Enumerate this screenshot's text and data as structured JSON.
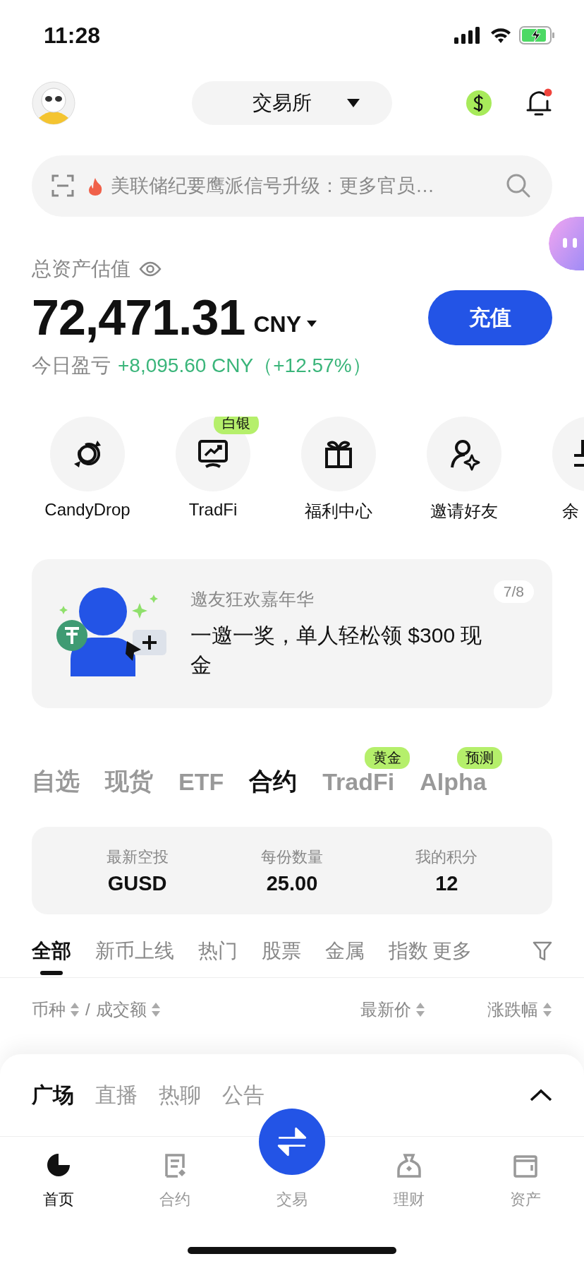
{
  "status_bar": {
    "time": "11:28"
  },
  "header": {
    "exchange_selector": {
      "label": "交易所"
    },
    "notifications": {
      "unread": true
    }
  },
  "search": {
    "placeholder": "美联储纪要鹰派信号升级：更多官员…"
  },
  "assets": {
    "label": "总资产估值",
    "value": "72,471.31",
    "currency": "CNY",
    "pnl_label": "今日盈亏",
    "pnl_value": "+8,095.60 CNY（+12.57%）",
    "deposit_button": "充值"
  },
  "shortcuts": [
    {
      "label": "CandyDrop"
    },
    {
      "label": "TradFi",
      "badge": "白银"
    },
    {
      "label": "福利中心"
    },
    {
      "label": "邀请好友"
    },
    {
      "label": "余"
    }
  ],
  "banner": {
    "title": "邀友狂欢嘉年华",
    "text": "一邀一奖，单人轻松领 $300 现金",
    "pager": "7/8"
  },
  "market_tabs": [
    {
      "label": "自选",
      "selected": false
    },
    {
      "label": "现货",
      "selected": false
    },
    {
      "label": "ETF",
      "selected": false
    },
    {
      "label": "合约",
      "selected": true
    },
    {
      "label": "TradFi",
      "selected": false,
      "badge": "黄金"
    },
    {
      "label": "Alpha",
      "selected": false,
      "badge": "预测"
    }
  ],
  "airdrop": [
    {
      "label": "最新空投",
      "value": "GUSD"
    },
    {
      "label": "每份数量",
      "value": "25.00"
    },
    {
      "label": "我的积分",
      "value": "12"
    }
  ],
  "categories": {
    "items": [
      {
        "label": "全部",
        "selected": true
      },
      {
        "label": "新币上线",
        "selected": false
      },
      {
        "label": "热门",
        "selected": false
      },
      {
        "label": "股票",
        "selected": false
      },
      {
        "label": "金属",
        "selected": false
      },
      {
        "label": "指数",
        "selected": false
      }
    ],
    "more": "更多"
  },
  "list_header": {
    "columns": [
      {
        "label": "币种"
      },
      {
        "label": "成交额"
      },
      {
        "label": "最新价"
      },
      {
        "label": "涨跌幅"
      }
    ],
    "separator": "/"
  },
  "feed": {
    "tabs": [
      {
        "label": "广场",
        "selected": true
      },
      {
        "label": "直播",
        "selected": false
      },
      {
        "label": "热聊",
        "selected": false
      },
      {
        "label": "公告",
        "selected": false
      }
    ]
  },
  "tab_bar": [
    {
      "label": "首页",
      "selected": true,
      "kind": "tab"
    },
    {
      "label": "合约",
      "selected": false,
      "kind": "tab"
    },
    {
      "label": "交易",
      "selected": false,
      "kind": "fab"
    },
    {
      "label": "理财",
      "selected": false,
      "kind": "tab"
    },
    {
      "label": "资产",
      "selected": false,
      "kind": "tab"
    }
  ]
}
